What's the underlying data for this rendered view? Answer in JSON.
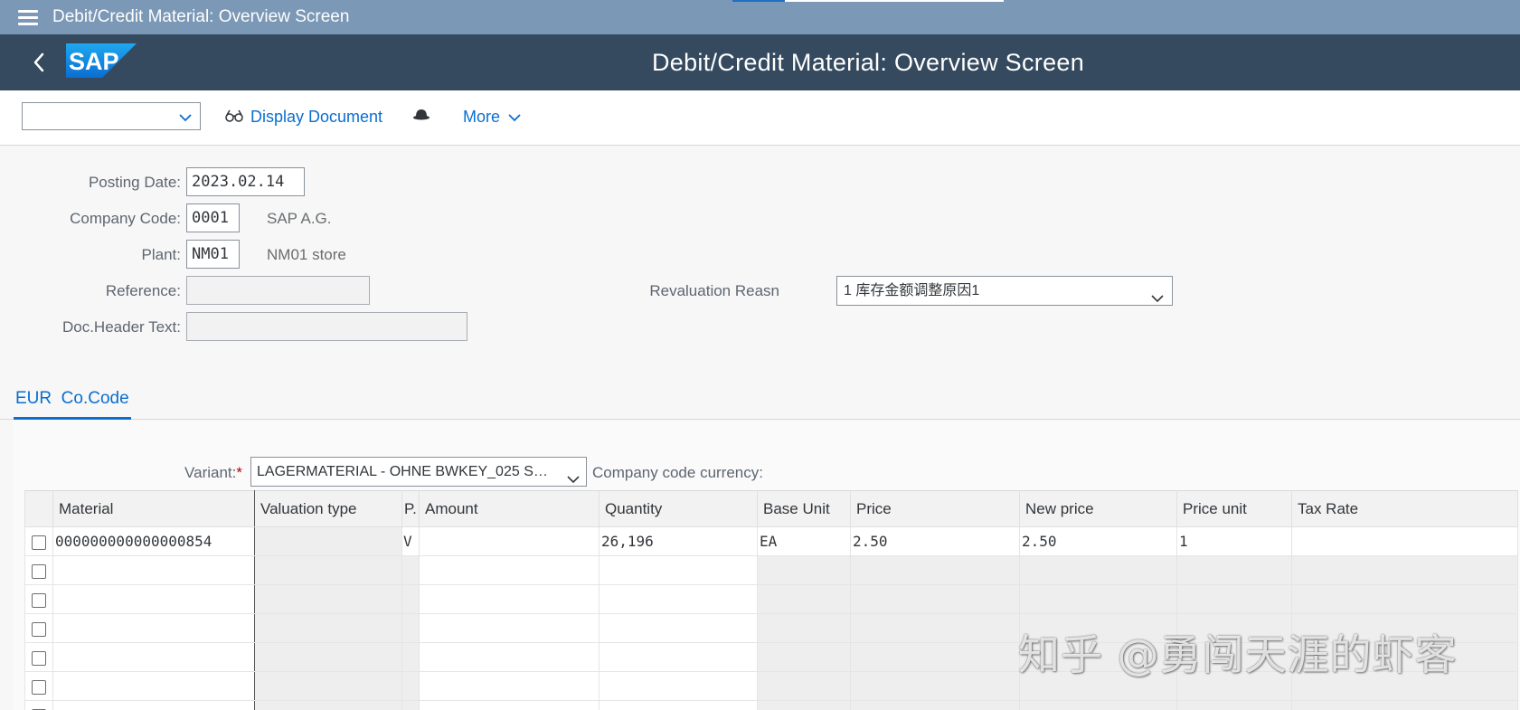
{
  "window": {
    "title": "Debit/Credit Material: Overview Screen"
  },
  "shell": {
    "title": "Debit/Credit Material: Overview Screen",
    "logo_text": "SAP"
  },
  "toolbar": {
    "dropdown_value": "",
    "display_document": "Display Document",
    "more": "More"
  },
  "form": {
    "posting_date": {
      "label": "Posting Date:",
      "value": "2023.02.14"
    },
    "company_code": {
      "label": "Company Code:",
      "value": "0001",
      "desc": "SAP A.G."
    },
    "plant": {
      "label": "Plant:",
      "value": "NM01",
      "desc": "NM01 store"
    },
    "reference": {
      "label": "Reference:",
      "value": ""
    },
    "doc_header_text": {
      "label": "Doc.Header Text:",
      "value": ""
    },
    "revaluation_reason": {
      "label": "Revaluation Reasn",
      "value": "1 库存金额调整原因1"
    }
  },
  "tabs": [
    {
      "label": "EUR  Co.Code",
      "active": true
    }
  ],
  "grid": {
    "variant_label": "Variant:",
    "variant_required": "*",
    "variant_value": "LAGERMATERIAL - OHNE BWKEY_025 S…",
    "currency_label": "Company code currency:",
    "columns": [
      "Material",
      "Valuation type",
      "P.",
      "Amount",
      "Quantity",
      "Base Unit",
      "Price",
      "New price",
      "Price unit",
      "Tax Rate"
    ],
    "rows": [
      [
        "000000000000000854",
        "",
        "V",
        "",
        "26,196",
        "EA",
        "2.50",
        "2.50",
        "1",
        ""
      ],
      [
        "",
        "",
        "",
        "",
        "",
        "",
        "",
        "",
        "",
        ""
      ],
      [
        "",
        "",
        "",
        "",
        "",
        "",
        "",
        "",
        "",
        ""
      ],
      [
        "",
        "",
        "",
        "",
        "",
        "",
        "",
        "",
        "",
        ""
      ],
      [
        "",
        "",
        "",
        "",
        "",
        "",
        "",
        "",
        "",
        ""
      ],
      [
        "",
        "",
        "",
        "",
        "",
        "",
        "",
        "",
        "",
        ""
      ],
      [
        "",
        "",
        "",
        "",
        "",
        "",
        "",
        "",
        "",
        ""
      ]
    ]
  },
  "watermark": "知乎 @勇闯天涯的虾客",
  "colors": {
    "shell": "#354a5f",
    "window_bar": "#7b98b6",
    "accent": "#0a6ed1"
  }
}
